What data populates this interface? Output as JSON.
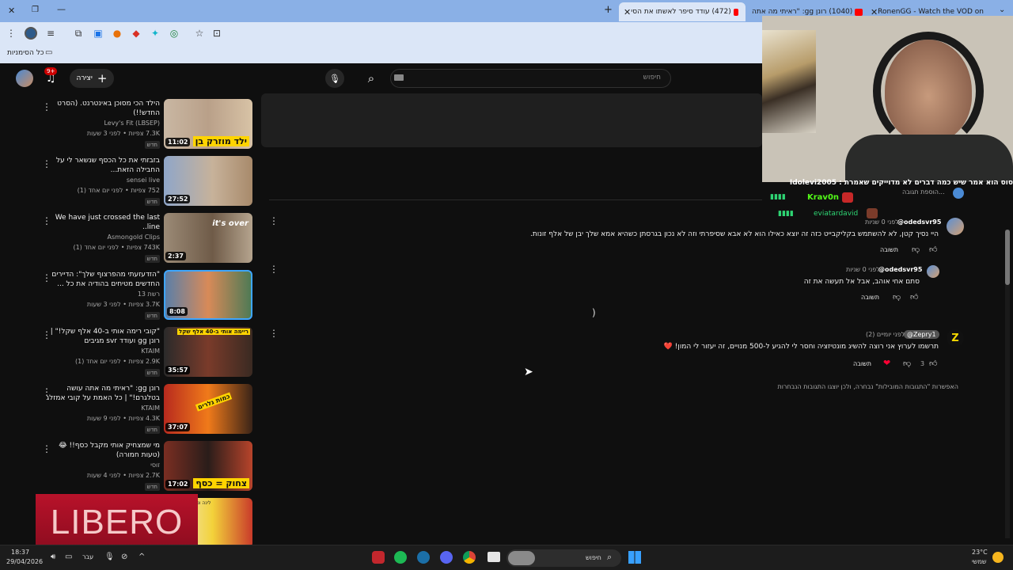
{
  "browser": {
    "tabs": [
      {
        "title": "RonenGG - Watch the VOD on",
        "active": false
      },
      {
        "title": "(1040) רונן gg: \"ראיתי מה אתה",
        "active": false
      },
      {
        "title": "(472) עודד סיפר לאשתו את הסי",
        "active": true
      }
    ],
    "bookmarks_label": "כל הסימניות"
  },
  "youtube": {
    "search_placeholder": "חיפוש",
    "create_label": "יצירה",
    "notif_badge": "9+"
  },
  "videos": [
    {
      "title": "הילד הכי מסוכן באינטרנט. (הסרט החדש!!)",
      "channel": "Levy's Fit (LBSEP)",
      "meta": "7.3K צפיות • לפני 3 שעות",
      "badge": "חדש",
      "duration": "11:02",
      "thumb_text": "ילד מוזרק בן"
    },
    {
      "title": "בזבזתי את כל הכסף שנשאר לי על החבילה הזאת...",
      "channel": "sensei live",
      "meta": "752 צפיות • לפני יום אחד (1)",
      "badge": "חדש",
      "duration": "27:52",
      "thumb_text": ""
    },
    {
      "title": "We have just crossed the last line..",
      "channel": "Asmongold Clips",
      "meta": "743K צפיות • לפני יום אחד (1)",
      "badge": "חדש",
      "duration": "2:37",
      "thumb_text": "it's over"
    },
    {
      "title": "\"הזדעזעתי מהפרצוף שלך\": הדיירים החדשים מטיחים בהודיה את כל ...",
      "channel": "רשת 13",
      "meta": "3.7K צפיות • לפני 3 שעות",
      "badge": "חדש",
      "duration": "8:08",
      "thumb_text": ""
    },
    {
      "title": "\"קובי רימה אותי ב-40 אלף שקל!\" | רונן gg ועודד svr מגיבים",
      "channel": "KTAIM",
      "meta": "2.9K צפיות • לפני יום אחד (1)",
      "badge": "חדש",
      "duration": "35:57",
      "thumb_text": "ריימה אותי ב-40 אלף שקל"
    },
    {
      "title": "רונן gg: \"ראיתי מה אתה עושה בטלגרם!\" | כל האמת על קובי אמזלג",
      "channel": "KTAIM",
      "meta": "4.3K צפיות • לפני 9 שעות",
      "badge": "חדש",
      "duration": "37:07",
      "thumb_text": "כמות גלרים"
    },
    {
      "title": "מי שמצחיק אותי מקבל כסף!! 😂 (טעות חמורה)",
      "channel": "זוסי",
      "meta": "2.7K צפיות • לפני 4 שעות",
      "badge": "חדש",
      "duration": "17:02",
      "thumb_text": "צחוק = כסף"
    },
    {
      "title": "",
      "channel": "",
      "meta": "",
      "badge": "",
      "duration": "",
      "thumb_text": "לינה ונקשת"
    }
  ],
  "chat": {
    "line1": "סוס הוא אמר שיש כמה דברים לא מדוייקים שאמרת : Idolevi2005",
    "line1_user": "Idolevi2005",
    "add_label": "הוספת תגובה...",
    "line2_user": "Krav0n",
    "line3_user": "eviatardavid"
  },
  "comments": [
    {
      "user": "@odedsvr95",
      "time": "לפני 0 שניות",
      "text": "היי נסיך קטן, לא להשתמש בקליקבייט כזה זה יוצא כאילו הוא לא אבא שסיפרתי וזה לא נכון בגרסתן כשהיא אמא שלך יבן של אלף זונות.",
      "reply": "תשובה",
      "likes": ""
    },
    {
      "user": "@odedsvr95",
      "time": "לפני 0 שניות",
      "text": "סתם אחי אוהב, אבל אל תעשה את זה",
      "reply": "תשובה",
      "likes": ""
    },
    {
      "user": "@Zepry1",
      "time": "לפני יומיים (2)",
      "text": "תרשמו לערוץ אני רוצה להשיג מונטיזציה וחסר לי להגיע ל-500 מנויים, זה יעזור לי המון! ❤️",
      "reply": "תשובה",
      "likes": "3"
    }
  ],
  "comments_footer": "האפשרות \"התגובות המובילות\" נבחרה, ולכן יוצגו התגובות הנבחרות",
  "ad": {
    "text": "LIBERO"
  },
  "taskbar": {
    "time": "18:37",
    "date": "29/04/2026",
    "lang": "עבר",
    "search": "חיפוש",
    "temp": "23°C",
    "weather": "שמשי"
  },
  "colors": {
    "accent_red": "#ff0033",
    "chrome_blue": "#8ab0e6",
    "chrome_light": "#dbe6f7",
    "chat_green": "#2ed573",
    "chat_yellow": "#e0b74a"
  }
}
